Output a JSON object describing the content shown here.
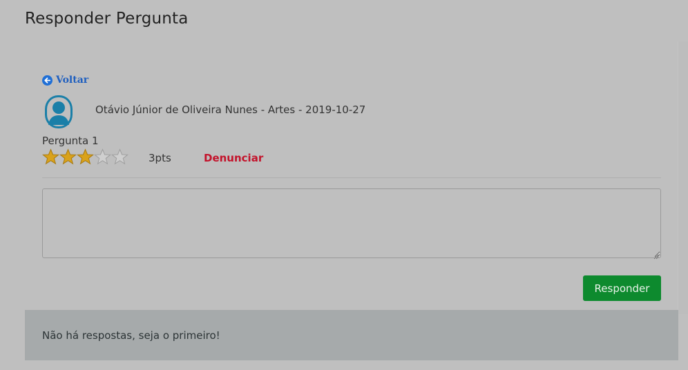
{
  "page": {
    "title": "Responder Pergunta"
  },
  "back": {
    "label": "Voltar",
    "icon": "arrow-circle-left-icon"
  },
  "question": {
    "author_line": "Otávio Júnior de Oliveira Nunes - Artes - 2019-10-27",
    "label": "Pergunta 1",
    "rating": {
      "filled": 3,
      "total": 5
    },
    "points": "3pts",
    "report_label": "Denunciar"
  },
  "answer_form": {
    "value": "",
    "submit_label": "Responder"
  },
  "answers": {
    "empty_message": "Não há respostas, seja o primeiro!"
  },
  "colors": {
    "background": "#bfbfbf",
    "link": "#1f5fbf",
    "report": "#c3132b",
    "submit": "#0d8a2e",
    "star_filled": "#d9a21b",
    "avatar": "#1a7fa8"
  }
}
